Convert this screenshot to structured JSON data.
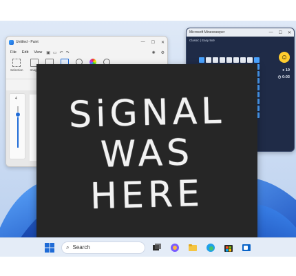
{
  "paint": {
    "title": "Untitled - Paint",
    "menu": [
      "File",
      "Edit",
      "View"
    ],
    "ribbon_labels": [
      "Selection",
      "Image"
    ],
    "size_value": "4",
    "controls": [
      "—",
      "☐",
      "✕"
    ]
  },
  "minesweeper": {
    "title": "Microsoft Minesweeper",
    "mode": "Classic | Easy 9x9",
    "mines_left": "10",
    "timer": "0:03",
    "controls": [
      "—",
      "☐",
      "✕"
    ]
  },
  "overlay": {
    "lines": [
      "SiGNAL",
      "WAS",
      "HERE"
    ]
  },
  "taskbar": {
    "search_placeholder": "Search",
    "icons": [
      "windows-start-icon",
      "task-view-icon",
      "copilot-icon",
      "file-explorer-icon",
      "edge-icon",
      "store-icon",
      "outlook-icon"
    ]
  },
  "colors": {
    "accent": "#1f6bd6",
    "overlay_bg": "#262626",
    "mines_tile": "#4aa3ff"
  }
}
